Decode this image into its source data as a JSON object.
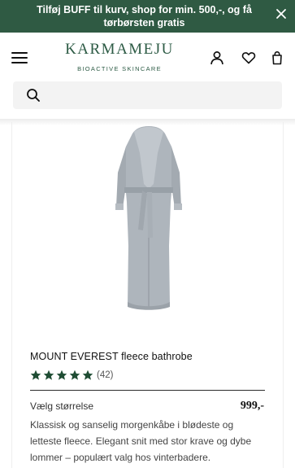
{
  "promo": {
    "text": "Tilføj BUFF til kurv, shop for min. 500,-, og få tørbørsten gratis"
  },
  "header": {
    "logo_main": "KARMAMEJU",
    "logo_sub": "BIOACTIVE SKINCARE",
    "icons": [
      "menu-icon",
      "user-icon",
      "heart-icon",
      "bag-icon"
    ]
  },
  "search": {
    "placeholder": "",
    "icon": "search-icon"
  },
  "product": {
    "title": "MOUNT EVEREST fleece bathrobe",
    "rating_stars": 5,
    "rating_count": "(42)",
    "size_label": "Vælg størrelse",
    "price": "999,-",
    "description": "Klassisk og sanselig morgenkåbe i blødeste og letteste fleece. Elegant snit med stor krave og dybe lommer – populært valg hos vinterbadere."
  },
  "colors": {
    "brand_green": "#2f5a43",
    "star_green": "#1f4d34"
  }
}
